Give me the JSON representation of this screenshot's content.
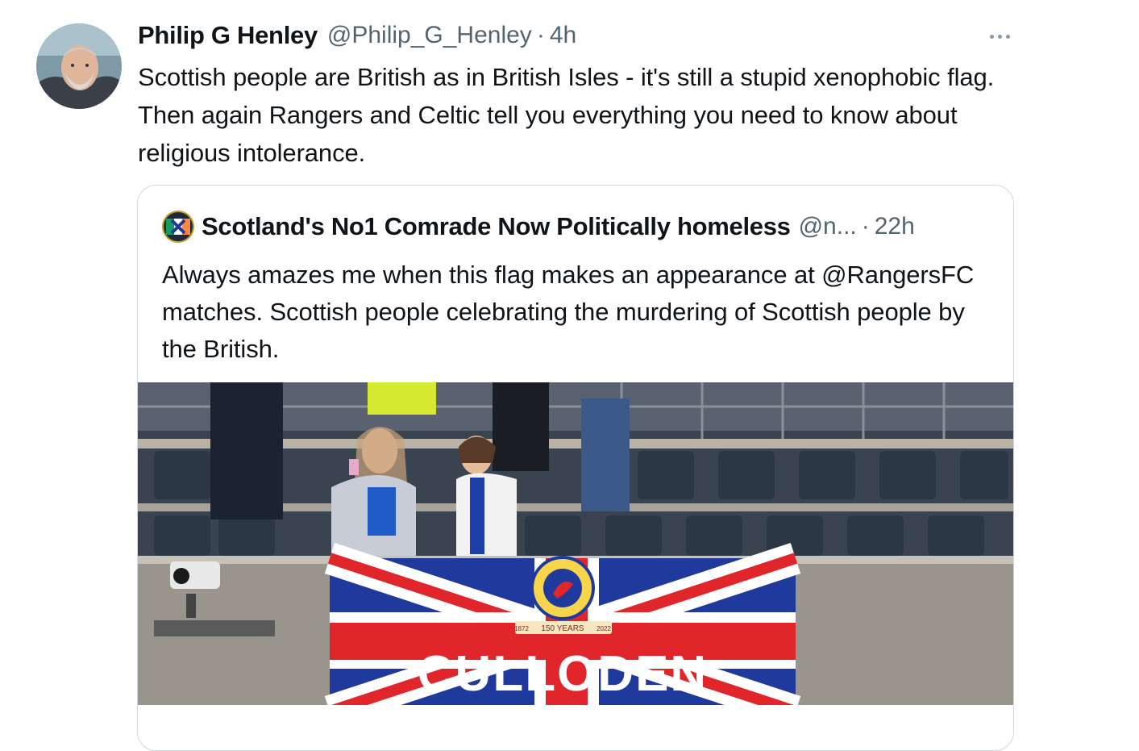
{
  "tweet": {
    "author_name": "Philip G Henley",
    "author_handle": "@Philip_G_Henley",
    "separator": "·",
    "time": "4h",
    "more_icon": "ellipsis-icon",
    "text": "Scottish people are British as in British Isles - it's still a stupid xenophobic flag. Then again Rangers and Celtic tell you everything you need to know about religious intolerance."
  },
  "quoted_tweet": {
    "author_name": "Scotland's No1 Comrade Now Politically homeless",
    "author_handle": "@n...",
    "separator": "·",
    "time": "22h",
    "text": "Always amazes me when this flag makes an appearance at @RangersFC matches. Scottish people celebrating the murdering of Scottish people by the British.",
    "image": {
      "flag_text": "CULLODEN",
      "crest_years": "150 YEARS",
      "crest_year_left": "1872",
      "crest_year_right": "2022"
    }
  },
  "colors": {
    "text": "#0f1419",
    "secondary": "#536471",
    "border": "#cfd9de",
    "flag_blue": "#1f3a9c",
    "flag_red": "#e0262b"
  }
}
